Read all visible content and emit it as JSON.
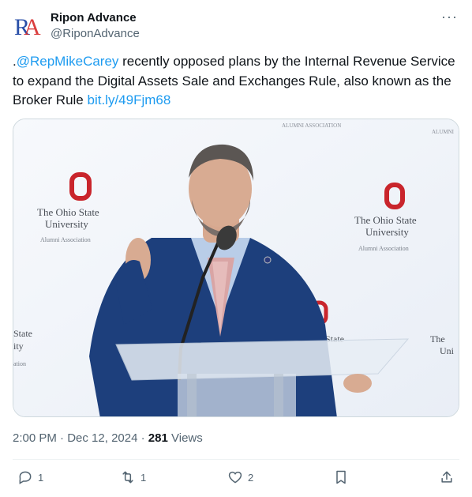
{
  "account": {
    "avatar_text": "RA",
    "display_name": "Ripon Advance",
    "handle": "@RiponAdvance"
  },
  "tweet": {
    "prefix": ".",
    "mention": "@RepMikeCarey",
    "body": " recently opposed plans by the Internal Revenue Service to expand the Digital Assets Sale and Exchanges Rule, also known as the Broker Rule ",
    "link": "bit.ly/49Fjm68"
  },
  "media": {
    "backdrop_lines": [
      "The Ohio State",
      "University",
      "Alumni Association"
    ]
  },
  "meta": {
    "time": "2:00 PM",
    "date": "Dec 12, 2024",
    "views_count": "281",
    "views_label": "Views"
  },
  "actions": {
    "reply_count": "1",
    "retweet_count": "1",
    "like_count": "2"
  },
  "colors": {
    "link": "#1d9bf0",
    "muted": "#536471",
    "text": "#0f1419",
    "brand_red": "#d62a2a",
    "brand_blue": "#2a4fa8"
  }
}
